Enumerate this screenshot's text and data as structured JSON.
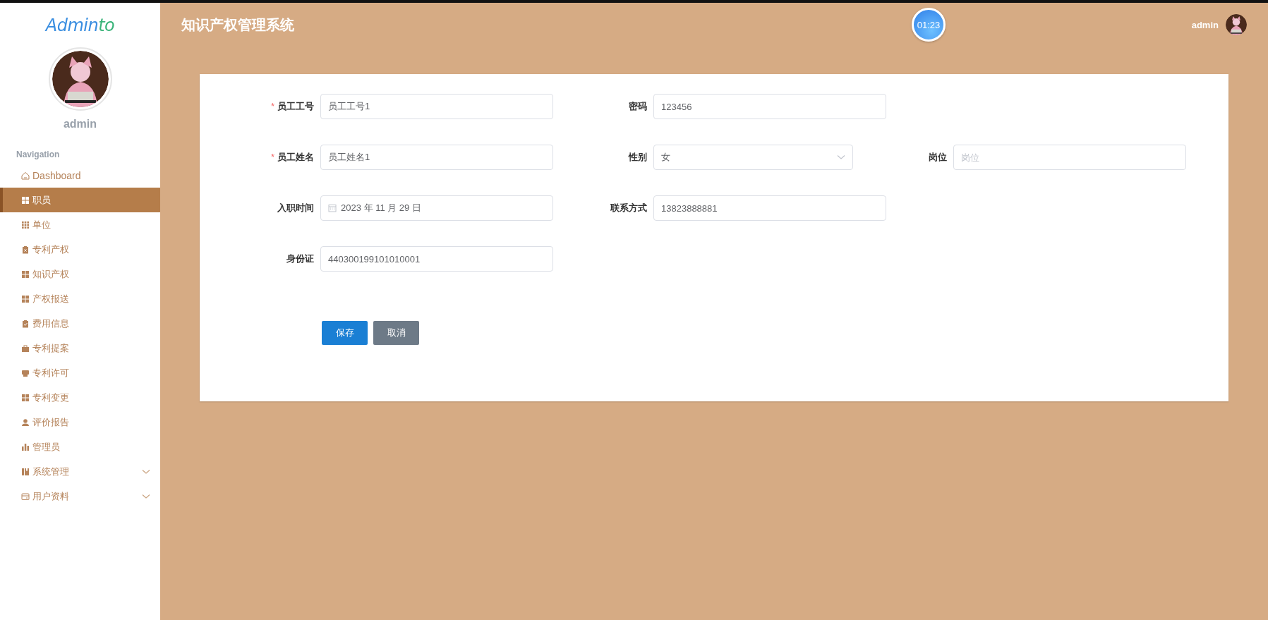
{
  "sidebar": {
    "logo": {
      "parts": [
        "Admin",
        "to"
      ]
    },
    "user_name": "admin",
    "nav_heading": "Navigation",
    "items": [
      {
        "label": "Dashboard",
        "kind": "link",
        "selected": false
      },
      {
        "label": "职员",
        "kind": "link",
        "selected": true
      },
      {
        "label": "单位",
        "kind": "link",
        "selected": false
      },
      {
        "label": "专利产权",
        "kind": "link",
        "selected": false
      },
      {
        "label": "知识产权",
        "kind": "link",
        "selected": false
      },
      {
        "label": "产权报送",
        "kind": "link",
        "selected": false
      },
      {
        "label": "费用信息",
        "kind": "link",
        "selected": false
      },
      {
        "label": "专利提案",
        "kind": "link",
        "selected": false
      },
      {
        "label": "专利许可",
        "kind": "link",
        "selected": false
      },
      {
        "label": "专利变更",
        "kind": "link",
        "selected": false
      },
      {
        "label": "评价报告",
        "kind": "link",
        "selected": false
      },
      {
        "label": "管理员",
        "kind": "link",
        "selected": false
      },
      {
        "label": "系统管理",
        "kind": "group",
        "selected": false,
        "expanded": false
      },
      {
        "label": "用户资料",
        "kind": "group",
        "selected": false,
        "expanded": false
      }
    ]
  },
  "header": {
    "title": "知识产权管理系统",
    "timer": "01:23",
    "user_name": "admin"
  },
  "form": {
    "rows": [
      [
        {
          "label": "员工工号",
          "required_mark": "*",
          "kind": "text",
          "value": "员工工号1"
        },
        {
          "label": "密码",
          "kind": "text",
          "value": "123456"
        }
      ],
      [
        {
          "label": "员工姓名",
          "required_mark": "*",
          "kind": "text",
          "value": "员工姓名1"
        },
        {
          "label": "性别",
          "kind": "select",
          "value": "女"
        },
        {
          "label": "岗位",
          "kind": "text",
          "placeholder": "岗位"
        }
      ],
      [
        {
          "label": "入职时间",
          "kind": "date",
          "value": "2023 年 11 月 29 日"
        },
        {
          "label": "联系方式",
          "kind": "text",
          "value": "13823888881"
        }
      ],
      [
        {
          "label": "身份证",
          "kind": "text",
          "value": "440300199101010001"
        }
      ]
    ],
    "buttons": [
      {
        "label": "保存",
        "kind": "primary"
      },
      {
        "label": "取消",
        "kind": "secondary"
      }
    ]
  }
}
